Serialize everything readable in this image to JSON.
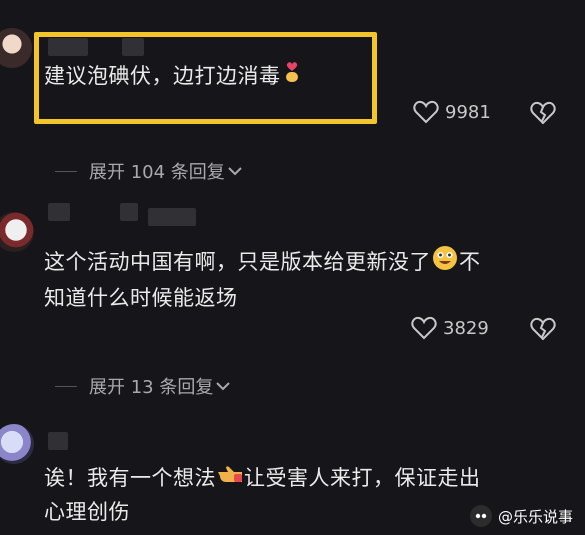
{
  "comments": [
    {
      "text_line1": "建议泡碘伏，边打边消毒",
      "likes": "9981",
      "expand": "展开 104 条回复"
    },
    {
      "text_line1": "这个活动中国有啊，只是版本给更新没了",
      "text_line1_tail": "不",
      "text_line2": "知道什么时候能返场",
      "likes": "3829",
      "expand": "展开 13 条回复"
    },
    {
      "text_line1": "诶！我有一个想法",
      "text_line1_tail": "让受害人来打，保证走出",
      "text_line2": "心理创伤"
    }
  ],
  "watermark": {
    "text": "@乐乐说事"
  },
  "colors": {
    "highlight": "#f2c52a",
    "background": "#161519"
  },
  "icons": [
    "heart-icon",
    "broken-heart-icon",
    "chevron-down-icon",
    "finger-heart-emoji",
    "grin-emoji",
    "pointing-hand-emoji"
  ]
}
